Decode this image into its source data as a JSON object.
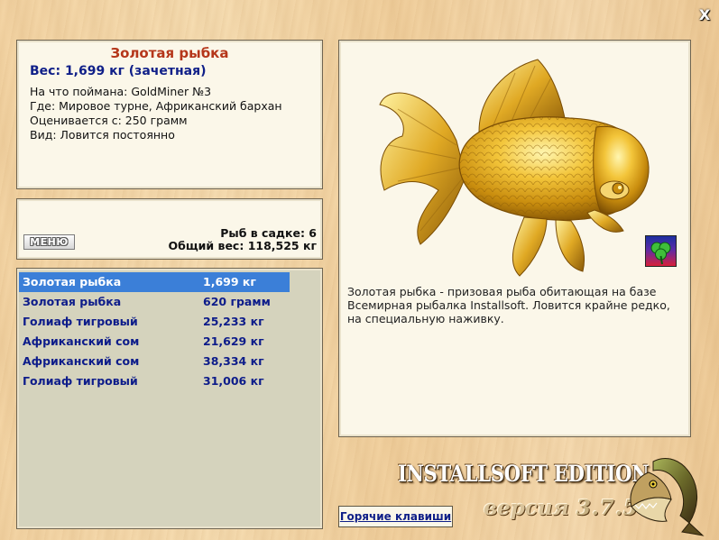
{
  "window": {
    "close_glyph": "X"
  },
  "fish_info": {
    "title": "Золотая рыбка",
    "weight": "Вес: 1,699 кг (зачетная)",
    "lines": [
      "На что поймана: GoldMiner №3",
      "Где: Мировое турне, Африканский бархан",
      "Оценивается с: 250 грамм",
      "Вид: Ловится постоянно"
    ]
  },
  "stats": {
    "menu_label": "МЕНЮ",
    "fish_in_keepnet": "Рыб в садке: 6",
    "total_weight": "Общий вес: 118,525 кг"
  },
  "catch_list": [
    {
      "name": "Золотая рыбка",
      "weight": "1,699 кг",
      "selected": true
    },
    {
      "name": "Золотая рыбка",
      "weight": "620 грамм"
    },
    {
      "name": "Голиаф тигровый",
      "weight": "25,233 кг"
    },
    {
      "name": "Африканский сом",
      "weight": "21,629 кг"
    },
    {
      "name": "Африканский сом",
      "weight": "38,334 кг"
    },
    {
      "name": "Голиаф тигровый",
      "weight": "31,006 кг"
    }
  ],
  "detail": {
    "image_icon": "goldfish-image",
    "badge_icon": "clover-icon",
    "description": "Золотая рыбка - призовая рыба обитающая на базе Всемирная рыбалка Installsoft. Ловится крайне редко, на специальную наживку."
  },
  "footer": {
    "hotkeys_label": "Горячие клавиши",
    "edition": "INSTALLSOFT EDITION",
    "version_word": "версия",
    "version_number": "3.7.5"
  },
  "colors": {
    "title_red": "#b5361a",
    "link_blue": "#0f1f88",
    "selection_blue": "#3b7fd8"
  }
}
